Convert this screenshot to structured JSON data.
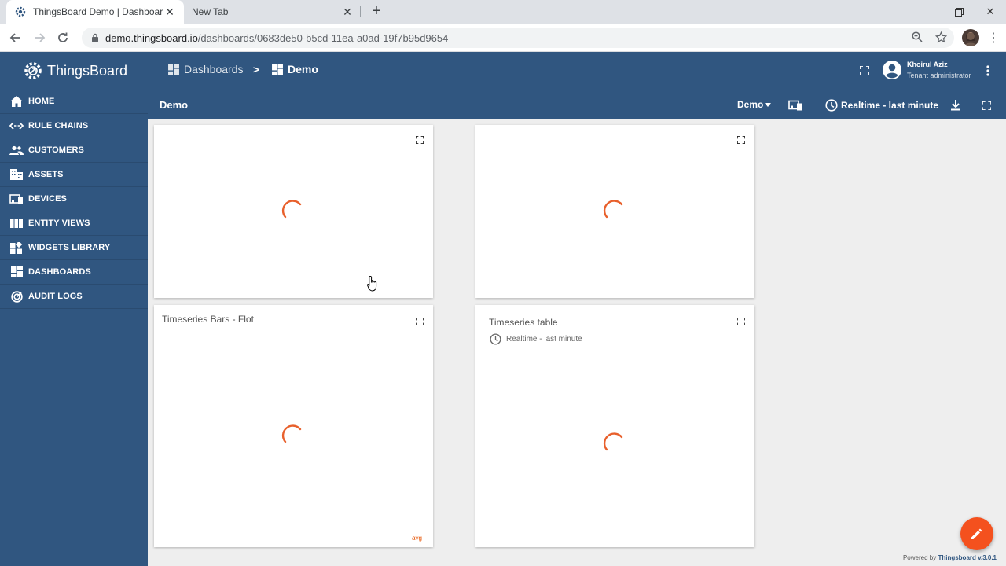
{
  "browser": {
    "tabs": [
      {
        "title": "ThingsBoard Demo | Dashboard",
        "active": true
      },
      {
        "title": "New Tab",
        "active": false
      }
    ],
    "url_host": "demo.thingsboard.io",
    "url_path": "/dashboards/0683de50-b5cd-11ea-a0ad-19f7b95d9654"
  },
  "app": {
    "logo_text": "ThingsBoard",
    "breadcrumbs": [
      {
        "label": "Dashboards"
      },
      {
        "label": "Demo"
      }
    ],
    "breadcrumb_separator": ">",
    "user": {
      "name": "Khoirul Aziz",
      "role": "Tenant administrator"
    },
    "menu": [
      {
        "label": "HOME",
        "icon": "home-icon"
      },
      {
        "label": "RULE CHAINS",
        "icon": "arrows-icon"
      },
      {
        "label": "CUSTOMERS",
        "icon": "people-icon"
      },
      {
        "label": "ASSETS",
        "icon": "building-icon"
      },
      {
        "label": "DEVICES",
        "icon": "devices-icon"
      },
      {
        "label": "ENTITY VIEWS",
        "icon": "view-module-icon"
      },
      {
        "label": "WIDGETS LIBRARY",
        "icon": "widgets-icon"
      },
      {
        "label": "DASHBOARDS",
        "icon": "dashboard-icon"
      },
      {
        "label": "AUDIT LOGS",
        "icon": "track-changes-icon"
      }
    ]
  },
  "toolbar": {
    "dashboard_title": "Demo",
    "state_selector": "Demo",
    "timewindow": "Realtime - last minute"
  },
  "widgets": [
    {
      "title": "",
      "subtitle": "",
      "footer": ""
    },
    {
      "title": "",
      "subtitle": "",
      "footer": ""
    },
    {
      "title": "Timeseries Bars - Flot",
      "subtitle": "",
      "footer": "avg"
    },
    {
      "title": "Timeseries table",
      "subtitle": "Realtime - last minute",
      "footer": ""
    }
  ],
  "footer": {
    "powered_prefix": "Powered by",
    "powered_brand": "Thingsboard v.3.0.1"
  },
  "colors": {
    "primary": "#305680",
    "accent": "#f4511e",
    "spinner": "#e8602c"
  }
}
